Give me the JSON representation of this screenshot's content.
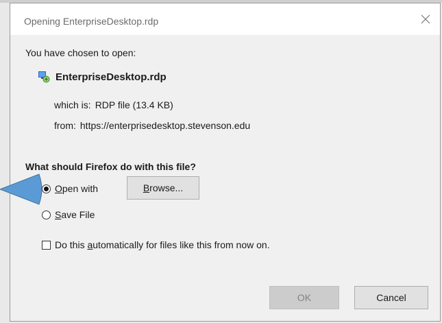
{
  "dialog": {
    "title": "Opening EnterpriseDesktop.rdp",
    "intro": "You have chosen to open:",
    "file_name": "EnterpriseDesktop.rdp",
    "which_label": "which is:",
    "which_value": "RDP file (13.4 KB)",
    "from_label": "from:",
    "from_value": "https://enterprisedesktop.stevenson.edu",
    "question": "What should Firefox do with this file?"
  },
  "options": {
    "open_with": {
      "prefix": "",
      "accel": "O",
      "rest": "pen with",
      "checked": true
    },
    "save_file": {
      "prefix": "",
      "accel": "S",
      "rest": "ave File",
      "checked": false
    },
    "browse": {
      "accel": "B",
      "rest": "rowse..."
    },
    "auto": {
      "prefix": "Do this ",
      "accel": "a",
      "rest": "utomatically for files like this from now on.",
      "checked": false
    }
  },
  "buttons": {
    "ok": "OK",
    "cancel": "Cancel"
  },
  "colors": {
    "callout": "#5b9bd5",
    "dialog_bg": "#f0f0f0",
    "ok_disabled_text": "#838383"
  },
  "icons": {
    "file": "rdp-file-icon",
    "close": "close-icon"
  }
}
